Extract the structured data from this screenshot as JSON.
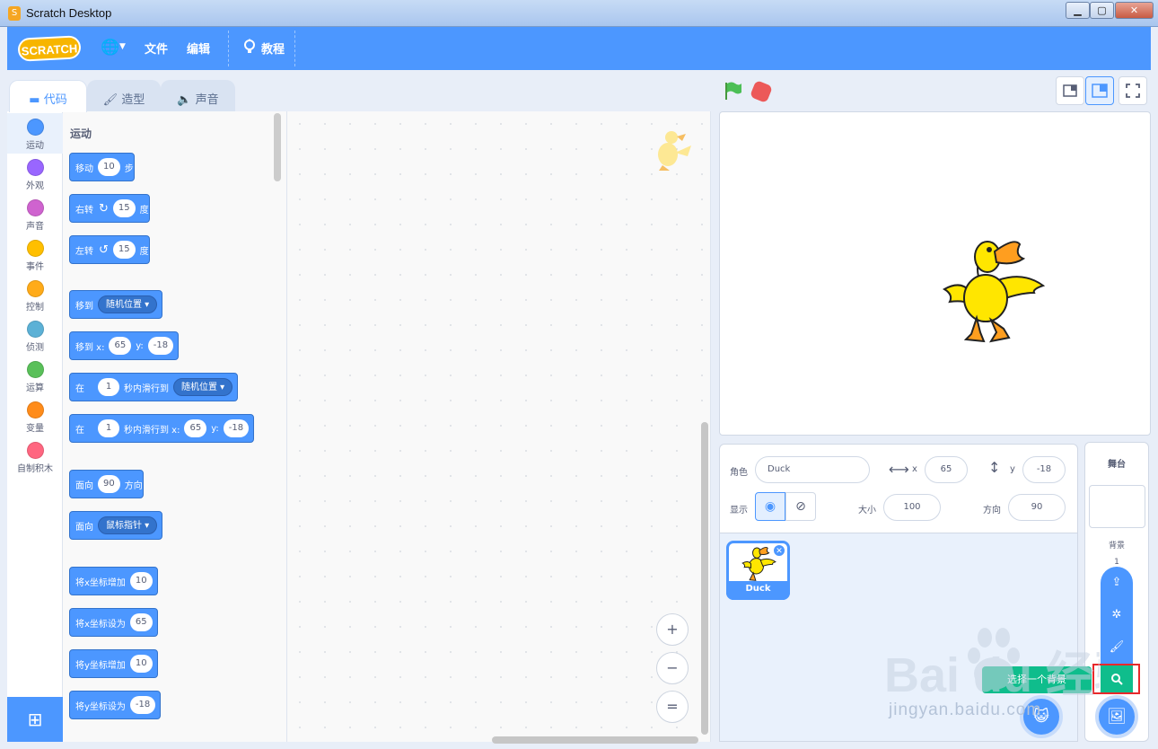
{
  "window": {
    "title": "Scratch Desktop",
    "min": "▁",
    "max": "▢",
    "close": "✕"
  },
  "menubar": {
    "logo": "SCRATCH",
    "file": "文件",
    "edit": "编辑",
    "tutorials": "教程"
  },
  "tabs": [
    {
      "label": "代码"
    },
    {
      "label": "造型"
    },
    {
      "label": "声音"
    }
  ],
  "categories": [
    {
      "label": "运动",
      "color": "#4c97ff"
    },
    {
      "label": "外观",
      "color": "#9966ff"
    },
    {
      "label": "声音",
      "color": "#cf63cf"
    },
    {
      "label": "事件",
      "color": "#ffbf00"
    },
    {
      "label": "控制",
      "color": "#ffab19"
    },
    {
      "label": "侦测",
      "color": "#5cb1d6"
    },
    {
      "label": "运算",
      "color": "#59c059"
    },
    {
      "label": "变量",
      "color": "#ff8c1a"
    },
    {
      "label": "自制积木",
      "color": "#ff6680"
    }
  ],
  "palette": {
    "section_title": "运动",
    "blocks": {
      "move": {
        "pre": "移动",
        "value": "10",
        "post": "步"
      },
      "turn_right": {
        "pre": "右转",
        "value": "15",
        "post": "度"
      },
      "turn_left": {
        "pre": "左转",
        "value": "15",
        "post": "度"
      },
      "goto": {
        "pre": "移到",
        "option": "随机位置"
      },
      "goto_xy": {
        "pre": "移到 x:",
        "x": "65",
        "y_label": "y:",
        "y": "-18"
      },
      "glide": {
        "pre": "在",
        "secs": "1",
        "mid": "秒内滑行到",
        "option": "随机位置"
      },
      "glide_xy": {
        "pre": "在",
        "secs": "1",
        "mid": "秒内滑行到 x:",
        "x": "65",
        "y_label": "y:",
        "y": "-18"
      },
      "point": {
        "pre": "面向",
        "value": "90",
        "post": "方向"
      },
      "point_towards": {
        "pre": "面向",
        "option": "鼠标指针"
      },
      "change_x": {
        "pre": "将x坐标增加",
        "value": "10"
      },
      "set_x": {
        "pre": "将x坐标设为",
        "value": "65"
      },
      "change_y": {
        "pre": "将y坐标增加",
        "value": "10"
      },
      "set_y": {
        "pre": "将y坐标设为",
        "value": "-18"
      }
    }
  },
  "zoom": {
    "in": "+",
    "out": "−",
    "reset": "="
  },
  "sprite_info": {
    "sprite_label": "角色",
    "sprite_name": "Duck",
    "x_label": "x",
    "x": "65",
    "y_label": "y",
    "y": "-18",
    "show_label": "显示",
    "size_label": "大小",
    "size": "100",
    "direction_label": "方向",
    "direction": "90"
  },
  "sprites": [
    {
      "name": "Duck"
    }
  ],
  "stage_panel": {
    "title": "舞台",
    "backdrops_label": "背景",
    "backdrop_count": "1"
  },
  "backdrop_menu": {
    "choose_tooltip": "选择一个背景"
  },
  "watermark": {
    "text": "Bai du 经验",
    "url": "jingyan.baidu.com"
  },
  "colors": {
    "accent": "#4c97ff",
    "highlight_box": "#e8282b",
    "search_green": "#0fbd8c"
  }
}
